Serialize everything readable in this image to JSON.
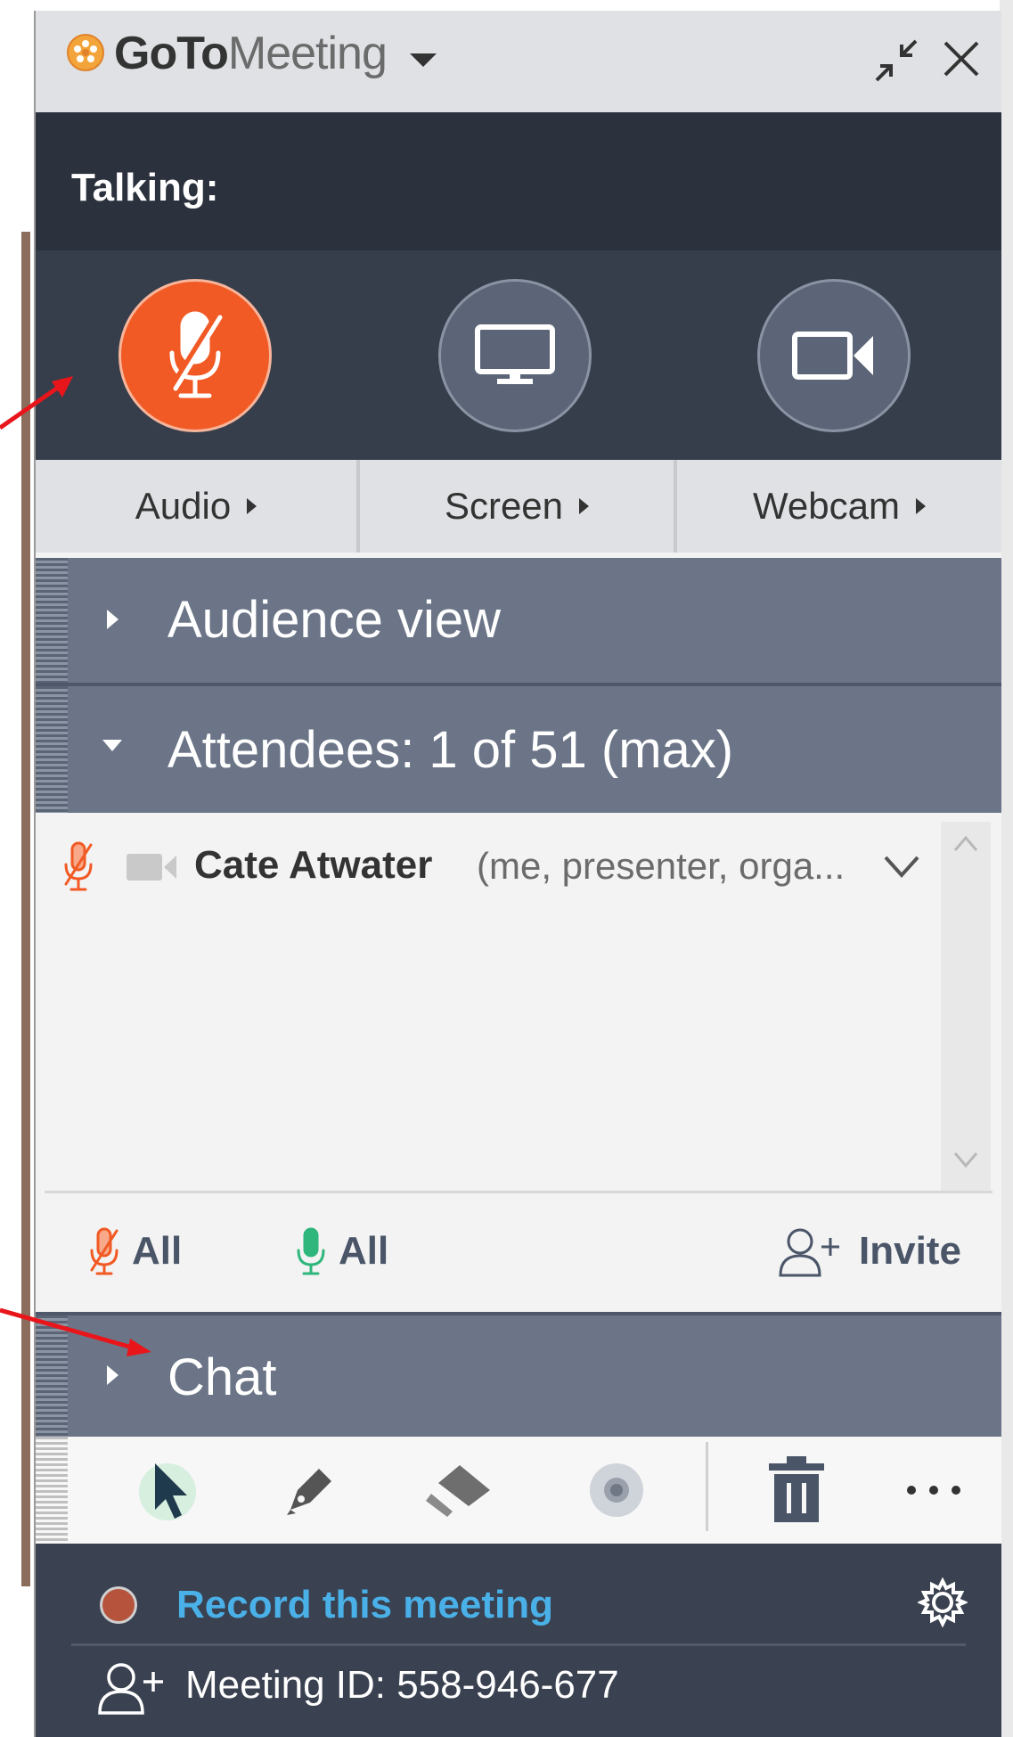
{
  "window": {
    "app_name_bold": "GoTo",
    "app_name_light": "Meeting"
  },
  "talking": {
    "label": "Talking:"
  },
  "media": {
    "audio_label": "Audio",
    "screen_label": "Screen",
    "webcam_label": "Webcam",
    "mic_state": "muted",
    "mic_color": "#f15a24"
  },
  "sections": {
    "audience_view": "Audience view",
    "attendees": "Attendees:  1 of 51 (max)",
    "chat": "Chat"
  },
  "attendees": [
    {
      "name": "Cate Atwater",
      "role": "(me, presenter, orga...",
      "mic": "muted"
    }
  ],
  "controls": {
    "mute_all_label": "All",
    "unmute_all_label": "All",
    "invite_label": "Invite"
  },
  "toolbar": {
    "tools": [
      "pointer-icon",
      "pen-icon",
      "highlighter-icon",
      "spotlight-icon",
      "trash-icon",
      "more-icon"
    ],
    "active_tool": "pointer-icon"
  },
  "footer": {
    "record_label": "Record this meeting",
    "meeting_id": "Meeting ID: 558-946-677"
  },
  "colors": {
    "accent_orange": "#f15a24",
    "link_blue": "#4ab0e8",
    "unmute_green": "#2fb67c",
    "annotation_red": "#e8161b"
  }
}
